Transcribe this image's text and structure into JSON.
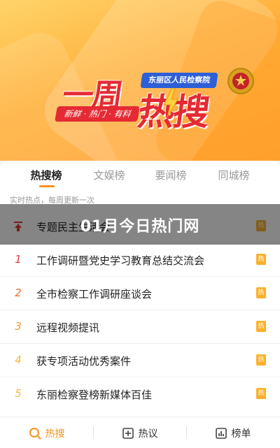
{
  "banner": {
    "logo_part1": "一周",
    "logo_part2": "热搜",
    "logo_tagline": "新鲜 · 热门 · 有料",
    "org_name": "东丽区人民检察院"
  },
  "tabs": [
    {
      "label": "热搜榜",
      "active": true
    },
    {
      "label": "文娱榜",
      "active": false
    },
    {
      "label": "要闻榜",
      "active": false
    },
    {
      "label": "同城榜",
      "active": false
    }
  ],
  "subtitle": "实时热点，每周更新一次",
  "list": [
    {
      "rank": "",
      "title": "专题民主生活会",
      "badge": "热",
      "pinned": true
    },
    {
      "rank": "1",
      "title": "工作调研暨党史学习教育总结交流会",
      "badge": "热"
    },
    {
      "rank": "2",
      "title": "全市检察工作调研座谈会",
      "badge": "热"
    },
    {
      "rank": "3",
      "title": "远程视频提讯",
      "badge": "热"
    },
    {
      "rank": "4",
      "title": "获专项活动优秀案件",
      "badge": "热"
    },
    {
      "rank": "5",
      "title": "东丽检察登榜新媒体百佳",
      "badge": "热"
    }
  ],
  "rank_colors": {
    "1": "#e23b3b",
    "2": "#f06a2c",
    "3": "#f59a23",
    "4": "#f6b73c",
    "5": "#f6b73c"
  },
  "overlay": {
    "title": "01月今日热门网"
  },
  "bottom_nav": [
    {
      "label": "热搜",
      "icon": "search-icon",
      "active": true
    },
    {
      "label": "热议",
      "icon": "discussion-icon",
      "active": false
    },
    {
      "label": "榜单",
      "icon": "chart-icon",
      "active": false
    }
  ]
}
